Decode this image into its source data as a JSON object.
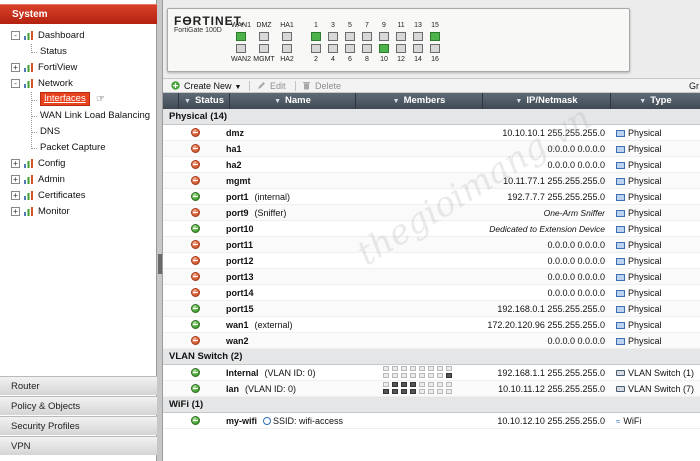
{
  "sidebar": {
    "header": "System",
    "tree": [
      {
        "label": "Dashboard",
        "level": 0,
        "expand": "-",
        "icon": "dashboard-icon"
      },
      {
        "label": "Status",
        "level": 1,
        "icon": "status-icon"
      },
      {
        "label": "FortiView",
        "level": 0,
        "expand": "+",
        "icon": "fortiview-icon"
      },
      {
        "label": "Network",
        "level": 0,
        "expand": "-",
        "icon": "network-icon"
      },
      {
        "label": "Interfaces",
        "level": 1,
        "selected": true
      },
      {
        "label": "WAN Link Load Balancing",
        "level": 1
      },
      {
        "label": "DNS",
        "level": 1
      },
      {
        "label": "Packet Capture",
        "level": 1
      },
      {
        "label": "Config",
        "level": 0,
        "expand": "+",
        "icon": "config-icon"
      },
      {
        "label": "Admin",
        "level": 0,
        "expand": "+",
        "icon": "admin-icon"
      },
      {
        "label": "Certificates",
        "level": 0,
        "expand": "+",
        "icon": "certificates-icon"
      },
      {
        "label": "Monitor",
        "level": 0,
        "expand": "+",
        "icon": "monitor-icon"
      }
    ],
    "bottom_nav": [
      "Router",
      "Policy & Objects",
      "Security Profiles",
      "VPN"
    ]
  },
  "device": {
    "brand": "FӨRTINET.",
    "model": "FortiGate 100D",
    "top_labels": [
      "WAN1",
      "DMZ",
      "HA1",
      "1",
      "3",
      "5",
      "7",
      "9",
      "11",
      "13",
      "15"
    ],
    "bottom_labels": [
      "WAN2",
      "MGMT",
      "HA2",
      "2",
      "4",
      "6",
      "8",
      "10",
      "12",
      "14",
      "16"
    ],
    "top_on": [
      true,
      false,
      false,
      true,
      false,
      false,
      false,
      false,
      false,
      false,
      true
    ],
    "bottom_on": [
      false,
      false,
      false,
      false,
      false,
      false,
      false,
      true,
      false,
      false,
      false
    ]
  },
  "toolbar": {
    "create_new": "Create New",
    "edit": "Edit",
    "delete": "Delete",
    "right_cut": "Gr"
  },
  "table": {
    "columns": [
      "Status",
      "Name",
      "Members",
      "IP/Netmask",
      "Type"
    ],
    "groups": [
      {
        "label": "Physical (14)",
        "rows": [
          {
            "status": "down",
            "name": "dmz",
            "note": "",
            "ip": "10.10.10.1 255.255.255.0",
            "ip_italic": false,
            "type": "Physical"
          },
          {
            "status": "down",
            "name": "ha1",
            "note": "",
            "ip": "0.0.0.0 0.0.0.0",
            "ip_italic": false,
            "type": "Physical"
          },
          {
            "status": "down",
            "name": "ha2",
            "note": "",
            "ip": "0.0.0.0 0.0.0.0",
            "ip_italic": false,
            "type": "Physical"
          },
          {
            "status": "down",
            "name": "mgmt",
            "note": "",
            "ip": "10.11.77.1 255.255.255.0",
            "ip_italic": false,
            "type": "Physical"
          },
          {
            "status": "up",
            "name": "port1",
            "note": "(internal)",
            "ip": "192.7.7.7 255.255.255.0",
            "ip_italic": false,
            "type": "Physical"
          },
          {
            "status": "down",
            "name": "port9",
            "note": "(Sniffer)",
            "ip": "One-Arm Sniffer",
            "ip_italic": true,
            "type": "Physical"
          },
          {
            "status": "up",
            "name": "port10",
            "note": "",
            "ip": "Dedicated to Extension Device",
            "ip_italic": true,
            "type": "Physical"
          },
          {
            "status": "down",
            "name": "port11",
            "note": "",
            "ip": "0.0.0.0 0.0.0.0",
            "ip_italic": false,
            "type": "Physical"
          },
          {
            "status": "down",
            "name": "port12",
            "note": "",
            "ip": "0.0.0.0 0.0.0.0",
            "ip_italic": false,
            "type": "Physical"
          },
          {
            "status": "down",
            "name": "port13",
            "note": "",
            "ip": "0.0.0.0 0.0.0.0",
            "ip_italic": false,
            "type": "Physical"
          },
          {
            "status": "down",
            "name": "port14",
            "note": "",
            "ip": "0.0.0.0 0.0.0.0",
            "ip_italic": false,
            "type": "Physical"
          },
          {
            "status": "up",
            "name": "port15",
            "note": "",
            "ip": "192.168.0.1 255.255.255.0",
            "ip_italic": false,
            "type": "Physical"
          },
          {
            "status": "up",
            "name": "wan1",
            "note": "(external)",
            "ip": "172.20.120.96 255.255.255.0",
            "ip_italic": false,
            "type": "Physical"
          },
          {
            "status": "down",
            "name": "wan2",
            "note": "",
            "ip": "0.0.0.0 0.0.0.0",
            "ip_italic": false,
            "type": "Physical"
          }
        ]
      },
      {
        "label": "VLAN Switch (2)",
        "rows": [
          {
            "status": "up",
            "name": "Internal",
            "note": "(VLAN ID: 0)",
            "ip": "192.168.1.1 255.255.255.0",
            "ip_italic": false,
            "type": "VLAN Switch (1)",
            "members_on": [
              16
            ]
          },
          {
            "status": "up",
            "name": "lan",
            "note": "(VLAN ID: 0)",
            "ip": "10.10.11.12 255.255.255.0",
            "ip_italic": false,
            "type": "VLAN Switch (7)",
            "members_on": [
              2,
              3,
              4,
              5,
              6,
              7,
              8
            ]
          }
        ]
      },
      {
        "label": "WiFi (1)",
        "rows": [
          {
            "status": "up",
            "name": "my-wifi",
            "note": "SSID: wifi-access",
            "ip": "10.10.12.10 255.255.255.0",
            "ip_italic": false,
            "type": "WiFi"
          }
        ]
      }
    ]
  },
  "watermark": "thegioimang.vn"
}
